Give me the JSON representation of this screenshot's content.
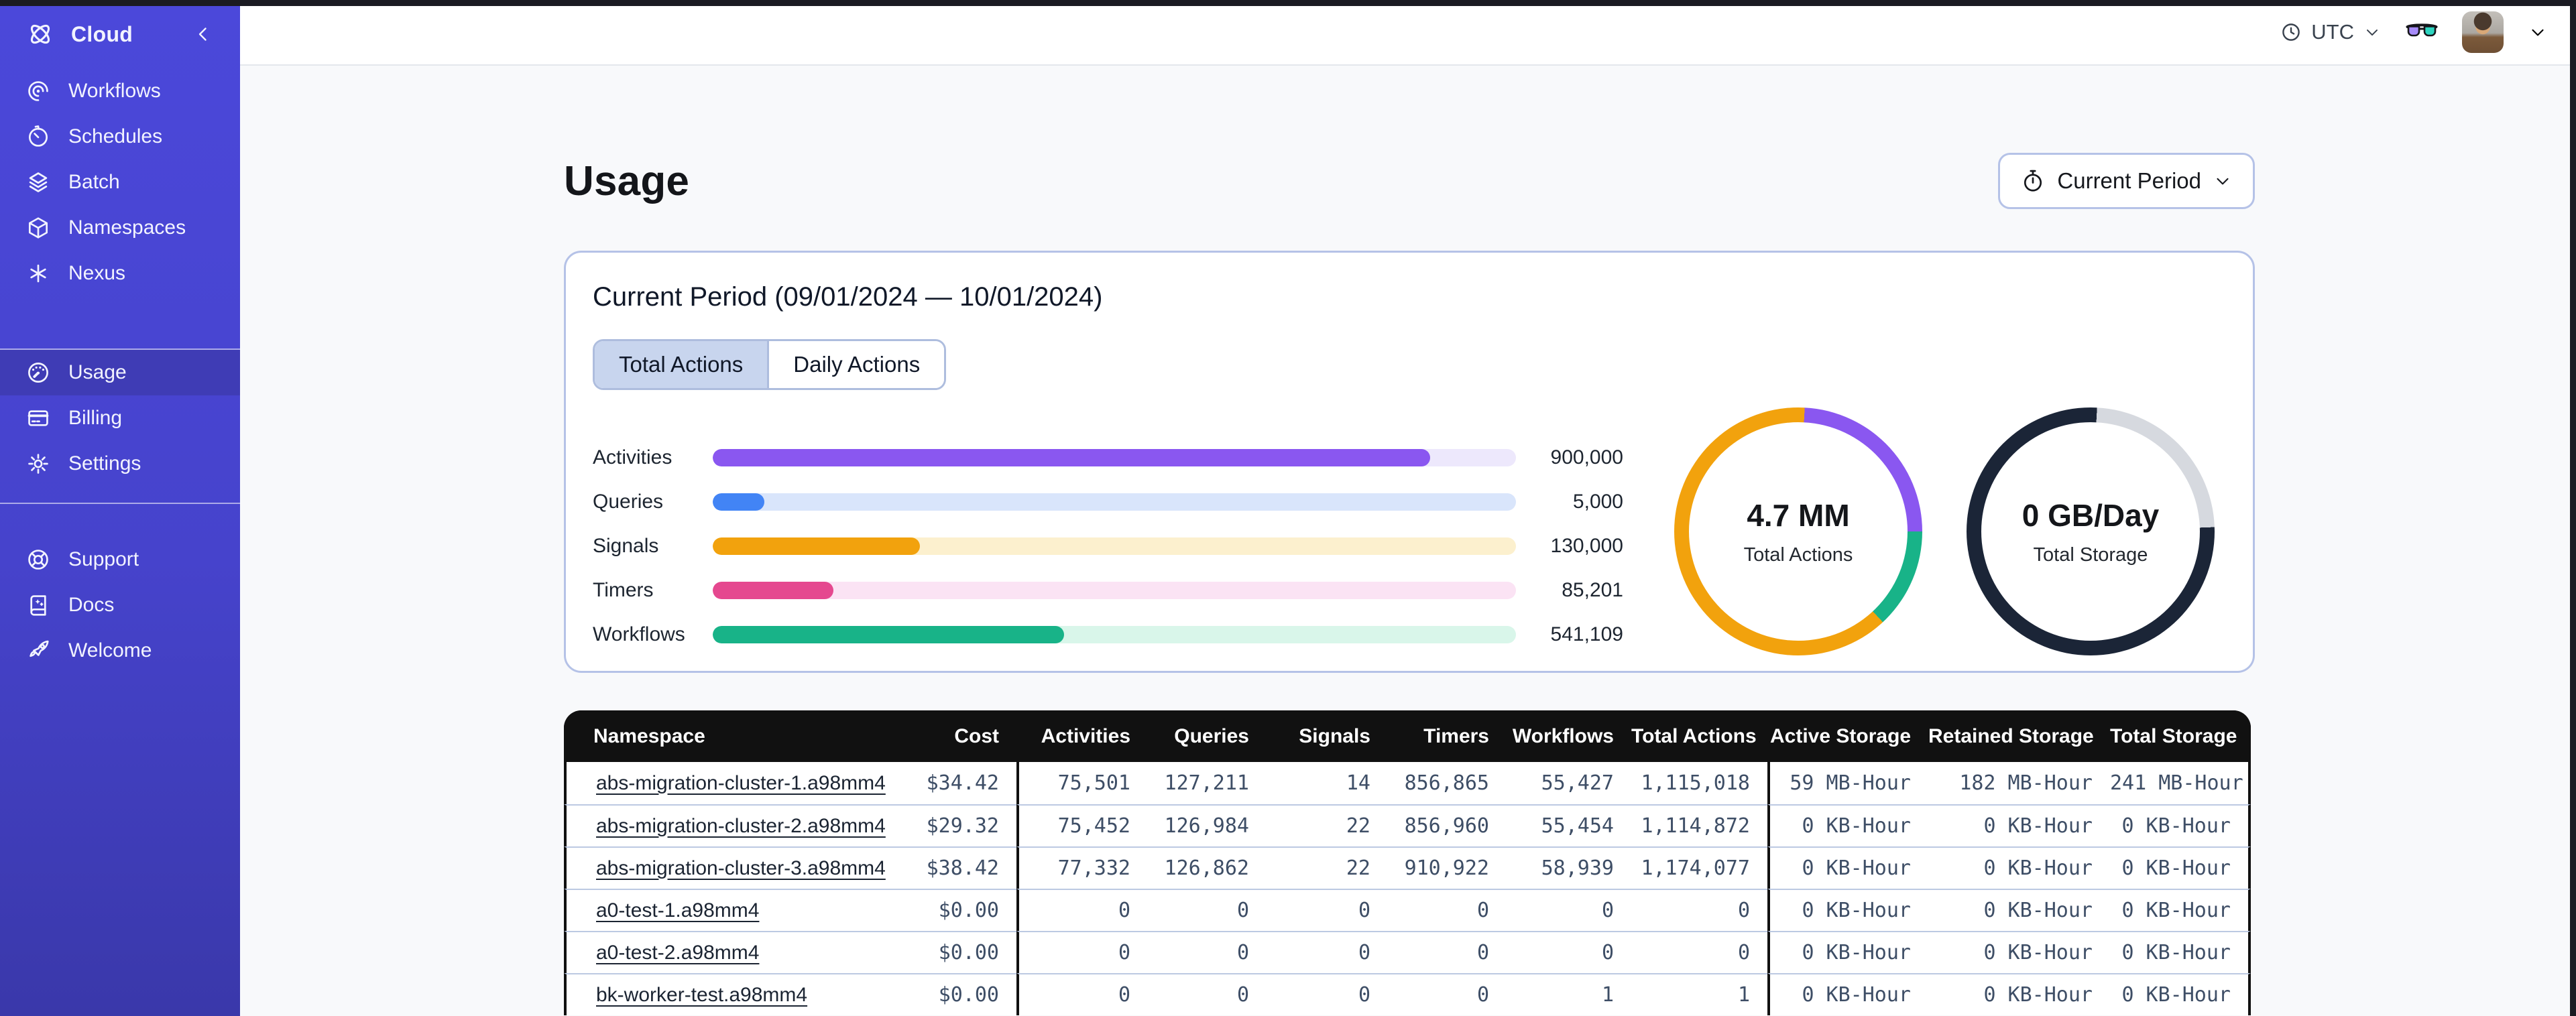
{
  "colors": {
    "sidebar_bg": "#4643CC",
    "sidebar_active_bg": "#3F3CB5",
    "accent_border": "#B5C2E7",
    "tab_selected_bg": "#C8D5EE",
    "table_header_bg": "#111111",
    "row_divider": "#BCC9E2",
    "activities": "#8A57F0",
    "queries": "#4284F5",
    "signals": "#F2A20D",
    "timers": "#E5488F",
    "workflows": "#18B388",
    "storage_dark": "#1B2537",
    "storage_gray": "#D6D9DF"
  },
  "sidebar": {
    "brand": {
      "label": "Cloud",
      "icon": "temporal-logo",
      "collapse_icon": "chevron-left"
    },
    "groups": [
      {
        "id": "nav-main",
        "items": [
          {
            "label": "Workflows",
            "icon": "workflows"
          },
          {
            "label": "Schedules",
            "icon": "schedules"
          },
          {
            "label": "Batch",
            "icon": "batch"
          },
          {
            "label": "Namespaces",
            "icon": "namespaces"
          },
          {
            "label": "Nexus",
            "icon": "nexus"
          }
        ]
      },
      {
        "id": "nav-account",
        "items": [
          {
            "label": "Usage",
            "icon": "usage",
            "active": true
          },
          {
            "label": "Billing",
            "icon": "billing"
          },
          {
            "label": "Settings",
            "icon": "settings"
          }
        ]
      },
      {
        "id": "nav-footer",
        "items": [
          {
            "label": "Support",
            "icon": "support"
          },
          {
            "label": "Docs",
            "icon": "docs"
          },
          {
            "label": "Welcome",
            "icon": "welcome"
          }
        ]
      }
    ]
  },
  "topbar": {
    "timezone": "UTC",
    "timezone_icon": "clock",
    "glasses_icon": "glasses",
    "avatar": "user-photo"
  },
  "page": {
    "title": "Usage",
    "period_button": {
      "label": "Current Period",
      "icon": "stopwatch"
    }
  },
  "panel": {
    "title": "Current Period (09/01/2024 — 10/01/2024)",
    "tabs": [
      {
        "label": "Total Actions",
        "active": true
      },
      {
        "label": "Daily Actions",
        "active": false
      }
    ]
  },
  "chart_data": [
    {
      "type": "bar",
      "orientation": "horizontal",
      "title": "Total Actions by type",
      "categories": [
        "Activities",
        "Queries",
        "Signals",
        "Timers",
        "Workflows"
      ],
      "values": [
        900000,
        5000,
        130000,
        85201,
        541109
      ],
      "value_labels": [
        "900,000",
        "5,000",
        "130,000",
        "85,201",
        "541,109"
      ],
      "fill_pct": [
        89.3,
        6.4,
        25.8,
        15.0,
        43.7
      ],
      "bar_colors": [
        "#8A57F0",
        "#4284F5",
        "#F2A20D",
        "#E5488F",
        "#18B388"
      ],
      "track_colors": [
        "#EDE8FC",
        "#D9E5FB",
        "#FCF0CE",
        "#FBE3F4",
        "#D9F6EA"
      ],
      "grid": false,
      "legend": false
    },
    {
      "type": "donut",
      "label": "4.7 MM",
      "sublabel": "Total Actions",
      "stops": [
        {
          "name": "signals-lead",
          "color": "#F2A20D",
          "to": 3
        },
        {
          "name": "activities",
          "color": "#8A57F0",
          "to": 90
        },
        {
          "name": "workflows",
          "color": "#18B388",
          "to": 137
        },
        {
          "name": "signals",
          "color": "#F2A20D",
          "to": 360
        }
      ]
    },
    {
      "type": "donut",
      "label": "0 GB/Day",
      "sublabel": "Total Storage",
      "stops": [
        {
          "name": "used-lead",
          "color": "#1B2537",
          "to": 3
        },
        {
          "name": "free",
          "color": "#D6D9DF",
          "to": 88
        },
        {
          "name": "used",
          "color": "#1B2537",
          "to": 360
        }
      ]
    }
  ],
  "table": {
    "columns": [
      {
        "label": "Namespace",
        "align": "left"
      },
      {
        "label": "Cost"
      },
      {
        "label": "Activities",
        "group": true
      },
      {
        "label": "Queries"
      },
      {
        "label": "Signals"
      },
      {
        "label": "Timers"
      },
      {
        "label": "Workflows"
      },
      {
        "label": "Total Actions"
      },
      {
        "label": "Active Storage",
        "group": true
      },
      {
        "label": "Retained Storage"
      },
      {
        "label": "Total Storage"
      }
    ],
    "rows": [
      [
        "abs-migration-cluster-1.a98mm4",
        "$34.42",
        "75,501",
        "127,211",
        "14",
        "856,865",
        "55,427",
        "1,115,018",
        "59 MB-Hour",
        "182 MB-Hour",
        "241 MB-Hour"
      ],
      [
        "abs-migration-cluster-2.a98mm4",
        "$29.32",
        "75,452",
        "126,984",
        "22",
        "856,960",
        "55,454",
        "1,114,872",
        "0 KB-Hour",
        "0 KB-Hour",
        "0 KB-Hour"
      ],
      [
        "abs-migration-cluster-3.a98mm4",
        "$38.42",
        "77,332",
        "126,862",
        "22",
        "910,922",
        "58,939",
        "1,174,077",
        "0 KB-Hour",
        "0 KB-Hour",
        "0 KB-Hour"
      ],
      [
        "a0-test-1.a98mm4",
        "$0.00",
        "0",
        "0",
        "0",
        "0",
        "0",
        "0",
        "0 KB-Hour",
        "0 KB-Hour",
        "0 KB-Hour"
      ],
      [
        "a0-test-2.a98mm4",
        "$0.00",
        "0",
        "0",
        "0",
        "0",
        "0",
        "0",
        "0 KB-Hour",
        "0 KB-Hour",
        "0 KB-Hour"
      ],
      [
        "bk-worker-test.a98mm4",
        "$0.00",
        "0",
        "0",
        "0",
        "0",
        "1",
        "1",
        "0 KB-Hour",
        "0 KB-Hour",
        "0 KB-Hour"
      ]
    ]
  }
}
